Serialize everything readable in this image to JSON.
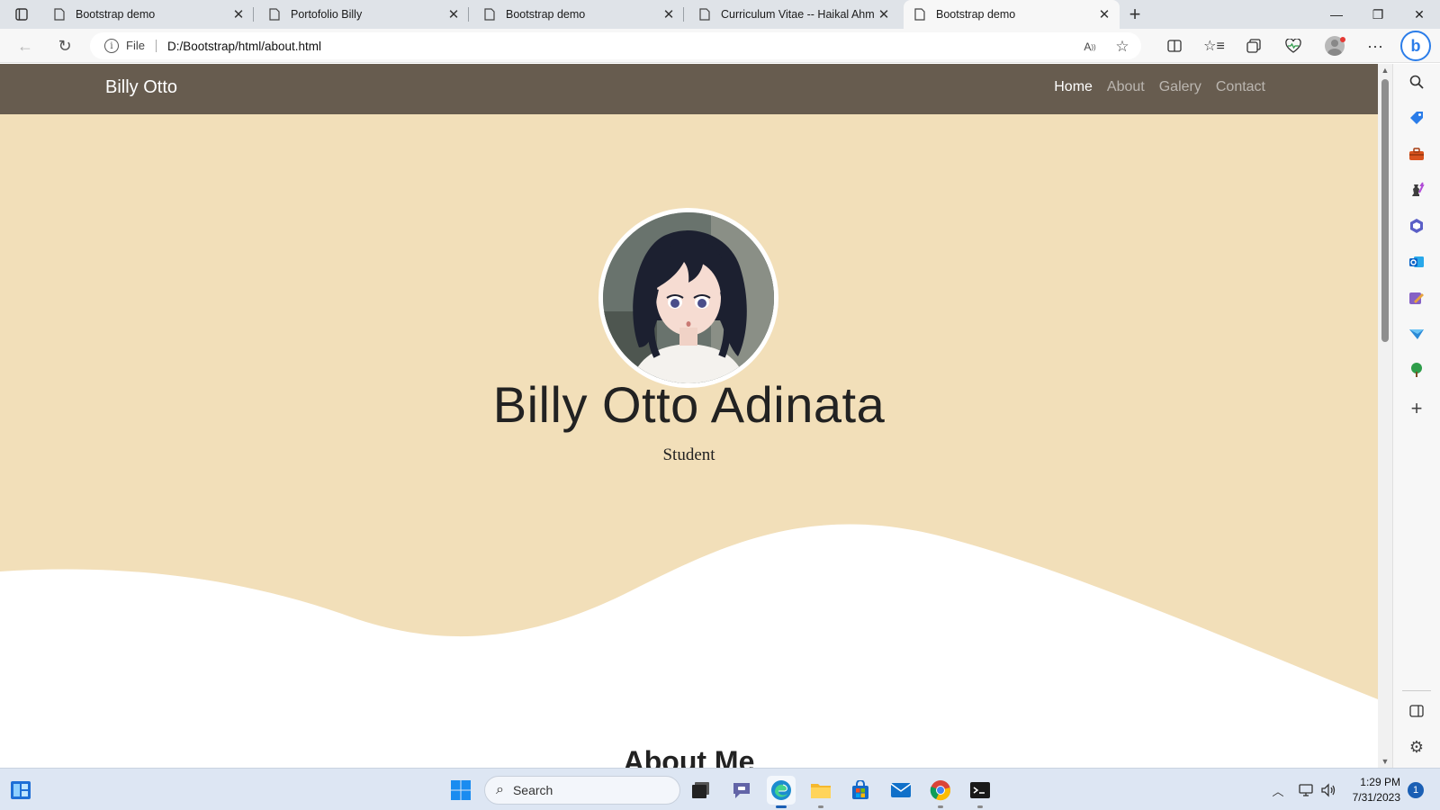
{
  "browser": {
    "tabs": [
      {
        "label": "Bootstrap demo",
        "active": false
      },
      {
        "label": "Portofolio Billy",
        "active": false
      },
      {
        "label": "Bootstrap demo",
        "active": false
      },
      {
        "label": "Curriculum Vitae -- Haikal Ahmad",
        "active": false
      },
      {
        "label": "Bootstrap demo",
        "active": true
      }
    ],
    "address": {
      "scheme_label": "File",
      "url": "D:/Bootstrap/html/about.html"
    }
  },
  "page": {
    "navbar": {
      "brand": "Billy Otto",
      "links": [
        {
          "label": "Home",
          "active": true
        },
        {
          "label": "About",
          "active": false
        },
        {
          "label": "Galery",
          "active": false
        },
        {
          "label": "Contact",
          "active": false
        }
      ]
    },
    "hero": {
      "name": "Billy Otto Adinata",
      "role": "Student"
    },
    "about_heading": "About Me"
  },
  "taskbar": {
    "search_placeholder": "Search",
    "time": "1:29 PM",
    "date": "7/31/2023",
    "notification_count": "1"
  },
  "colors": {
    "navbar_bg": "#675c4f",
    "hero_bg": "#f2dfb9",
    "accent_blue": "#2b7de9"
  }
}
